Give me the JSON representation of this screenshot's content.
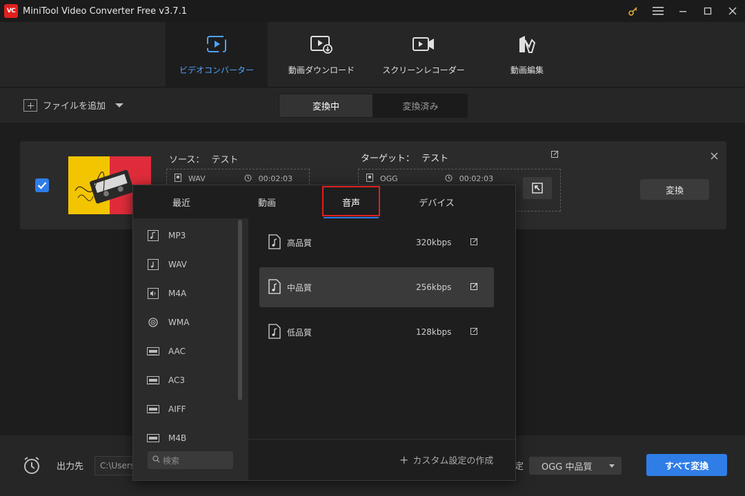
{
  "window": {
    "logo_text": "VC",
    "title": "MiniTool Video Converter Free v3.7.1",
    "controls": [
      "key-icon",
      "menu-icon",
      "minimize-icon",
      "maximize-icon",
      "close-icon"
    ]
  },
  "nav": {
    "items": [
      {
        "label": "ビデオコンバーター",
        "icon": "convert-icon",
        "active": true
      },
      {
        "label": "動画ダウンロード",
        "icon": "download-icon",
        "active": false
      },
      {
        "label": "スクリーンレコーダー",
        "icon": "camera-icon",
        "active": false
      },
      {
        "label": "動画編集",
        "icon": "edit-film-icon",
        "active": false
      }
    ],
    "accent": "#4fa3ff"
  },
  "toolbar": {
    "add_file_label": "ファイルを追加",
    "tabs": [
      {
        "label": "変換中",
        "active": true
      },
      {
        "label": "変換済み",
        "active": false
      }
    ]
  },
  "task": {
    "checked": true,
    "source_label": "ソース：",
    "source_name": "テスト",
    "source_format": "WAV",
    "source_duration": "00:02:03",
    "target_label": "ターゲット：",
    "target_name": "テスト",
    "target_format": "OGG",
    "target_duration": "00:02:03",
    "convert_label": "変換"
  },
  "popup": {
    "tabs": [
      {
        "label": "最近",
        "active": false
      },
      {
        "label": "動画",
        "active": false
      },
      {
        "label": "音声",
        "active": true
      },
      {
        "label": "デバイス",
        "active": false
      }
    ],
    "formats": [
      {
        "label": "MP3",
        "icon": "music-note-icon"
      },
      {
        "label": "WAV",
        "icon": "music-note-icon"
      },
      {
        "label": "M4A",
        "icon": "speaker-icon"
      },
      {
        "label": "WMA",
        "icon": "wma-icon"
      },
      {
        "label": "AAC",
        "icon": "aac-icon"
      },
      {
        "label": "AC3",
        "icon": "ac3-icon"
      },
      {
        "label": "AIFF",
        "icon": "aiff-icon"
      },
      {
        "label": "M4B",
        "icon": "m4b-icon"
      }
    ],
    "search_placeholder": "検索",
    "qualities": [
      {
        "name": "高品質",
        "bitrate": "320kbps",
        "selected": false
      },
      {
        "name": "中品質",
        "bitrate": "256kbps",
        "selected": true
      },
      {
        "name": "低品質",
        "bitrate": "128kbps",
        "selected": false
      }
    ],
    "custom_label": "カスタム設定の作成",
    "highlight_color": "#e02020"
  },
  "bottom": {
    "output_label": "出力先",
    "output_path": "C:\\Users",
    "format_suffix": "定",
    "format_value": "OGG 中品質",
    "convert_all_label": "すべて変換",
    "convert_all_color": "#2f7de6"
  }
}
